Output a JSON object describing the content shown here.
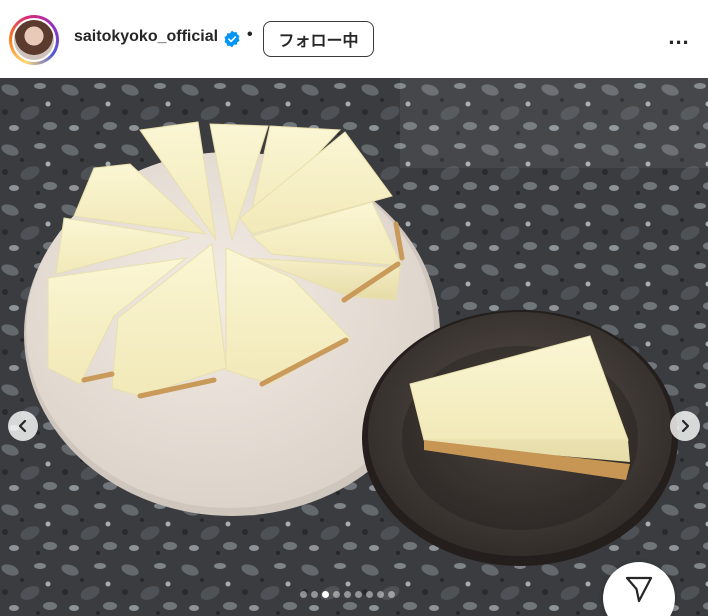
{
  "post_header": {
    "username": "saitokyoko_official",
    "separator": "•",
    "follow_label": "フォロー中",
    "more_label": "..."
  },
  "carousel": {
    "slide_count": 9,
    "active_index": 2
  },
  "colors": {
    "verified_badge": "#0095f6",
    "text": "#262626"
  },
  "icons": {
    "verified": "verified-badge-icon",
    "prev": "chevron-left-icon",
    "next": "chevron-right-icon",
    "share": "paper-plane-icon"
  }
}
